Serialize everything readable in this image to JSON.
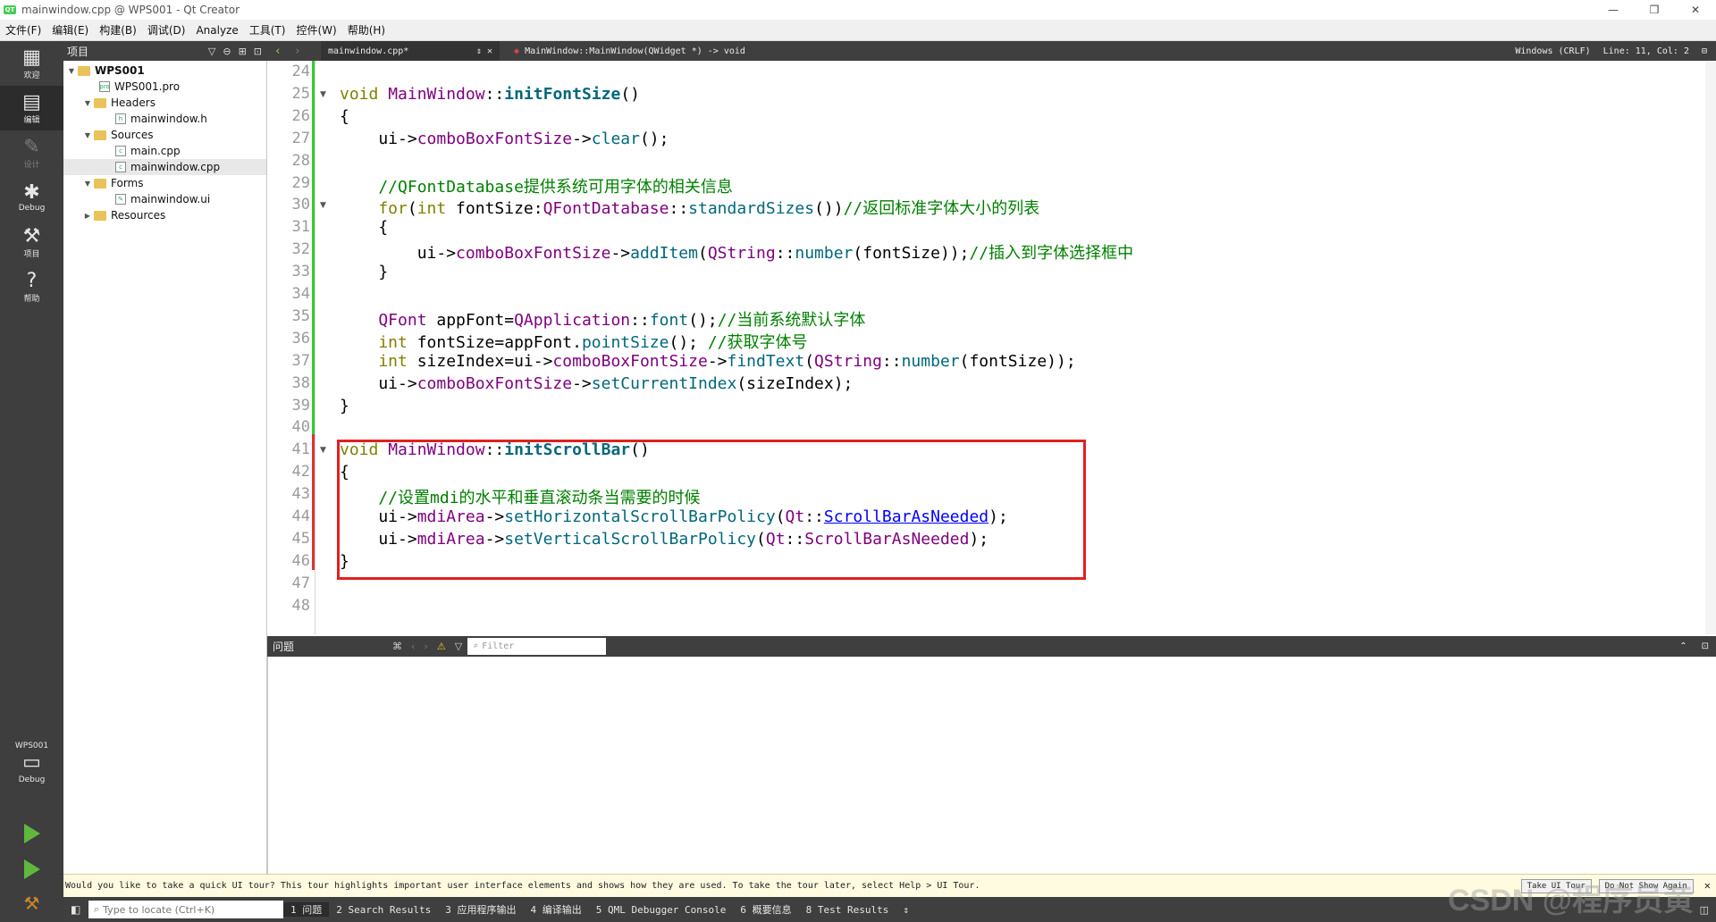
{
  "window": {
    "title": "mainwindow.cpp @ WPS001 - Qt Creator",
    "logo": "QT",
    "controls": [
      "—",
      "❐",
      "✕"
    ]
  },
  "menu": [
    "文件(F)",
    "编辑(E)",
    "构建(B)",
    "调试(D)",
    "Analyze",
    "工具(T)",
    "控件(W)",
    "帮助(H)"
  ],
  "modes": [
    {
      "label": "欢迎",
      "icon": "welcome-grid-icon"
    },
    {
      "label": "编辑",
      "icon": "edit-document-icon"
    },
    {
      "label": "设计",
      "icon": "design-pen-icon"
    },
    {
      "label": "Debug",
      "icon": "debug-bug-icon"
    },
    {
      "label": "项目",
      "icon": "project-wrench-icon"
    },
    {
      "label": "帮助",
      "icon": "help-question-icon"
    }
  ],
  "kit": {
    "project": "WPS001",
    "config": "Debug"
  },
  "project_pane": {
    "title": "项目",
    "tree": [
      "WPS001",
      "WPS001.pro",
      "Headers",
      "mainwindow.h",
      "Sources",
      "main.cpp",
      "mainwindow.cpp",
      "Forms",
      "mainwindow.ui",
      "Resources"
    ]
  },
  "editor": {
    "file_tab": "mainwindow.cpp*",
    "function": "MainWindow::MainWindow(QWidget *) -> void",
    "encoding": "Windows (CRLF)",
    "position": "Line: 11, Col: 2",
    "line_numbers": [
      "24",
      "25",
      "26",
      "27",
      "28",
      "29",
      "30",
      "31",
      "32",
      "33",
      "34",
      "35",
      "36",
      "37",
      "38",
      "39",
      "40",
      "41",
      "42",
      "43",
      "44",
      "45",
      "46",
      "47",
      "48"
    ],
    "code": {
      "l25_a": "void",
      "l25_b": " MainWindow",
      "l25_c": "::",
      "l25_d": "initFontSize",
      "l25_e": "()",
      "l26": "{",
      "l27_a": "    ui->",
      "l27_b": "comboBoxFontSize",
      "l27_c": "->",
      "l27_d": "clear",
      "l27_e": "();",
      "l29": "    //QFontDatabase提供系统可用字体的相关信息",
      "l30_a": "    for",
      "l30_b": "(",
      "l30_c": "int",
      "l30_d": " fontSize:",
      "l30_e": "QFontDatabase",
      "l30_f": "::",
      "l30_g": "standardSizes",
      "l30_h": "())",
      "l30_i": "//返回标准字体大小的列表",
      "l31": "    {",
      "l32_a": "        ui->",
      "l32_b": "comboBoxFontSize",
      "l32_c": "->",
      "l32_d": "addItem",
      "l32_e": "(",
      "l32_f": "QString",
      "l32_g": "::",
      "l32_h": "number",
      "l32_i": "(fontSize));",
      "l32_j": "//插入到字体选择框中",
      "l33": "    }",
      "l35_a": "    QFont",
      "l35_b": " appFont=",
      "l35_c": "QApplication",
      "l35_d": "::",
      "l35_e": "font",
      "l35_f": "();",
      "l35_g": "//当前系统默认字体",
      "l36_a": "    int",
      "l36_b": " fontSize=appFont.",
      "l36_c": "pointSize",
      "l36_d": "(); ",
      "l36_e": "//获取字体号",
      "l37_a": "    int",
      "l37_b": " sizeIndex=ui->",
      "l37_c": "comboBoxFontSize",
      "l37_d": "->",
      "l37_e": "findText",
      "l37_f": "(",
      "l37_g": "QString",
      "l37_h": "::",
      "l37_i": "number",
      "l37_j": "(fontSize));",
      "l38_a": "    ui->",
      "l38_b": "comboBoxFontSize",
      "l38_c": "->",
      "l38_d": "setCurrentIndex",
      "l38_e": "(sizeIndex);",
      "l39": "}",
      "l41_a": "void",
      "l41_b": " MainWindow",
      "l41_c": "::",
      "l41_d": "initScrollBar",
      "l41_e": "()",
      "l42": "{",
      "l43": "    //设置mdi的水平和垂直滚动条当需要的时候",
      "l44_a": "    ui->",
      "l44_b": "mdiArea",
      "l44_c": "->",
      "l44_d": "setHorizontalScrollBarPolicy",
      "l44_e": "(",
      "l44_f": "Qt",
      "l44_g": "::",
      "l44_h": "ScrollBarAsNeeded",
      "l44_i": ");",
      "l45_a": "    ui->",
      "l45_b": "mdiArea",
      "l45_c": "->",
      "l45_d": "setVerticalScrollBarPolicy",
      "l45_e": "(",
      "l45_f": "Qt",
      "l45_g": "::",
      "l45_h": "ScrollBarAsNeeded",
      "l45_i": ");",
      "l46": "}"
    }
  },
  "issues": {
    "title": "问题",
    "filter_placeholder": "Filter"
  },
  "tour": {
    "message": "Would you like to take a quick UI tour? This tour highlights important user interface elements and shows how they are used. To take the tour later, select Help > UI Tour.",
    "take_button": "Take UI Tour",
    "dismiss_button": "Do Not Show Again",
    "close": "✕"
  },
  "status": {
    "locate_placeholder": "Type to locate (Ctrl+K)",
    "tabs": [
      "1 问题",
      "2 Search Results",
      "3 应用程序输出",
      "4 编译输出",
      "5 QML Debugger Console",
      "6 概要信息",
      "8 Test Results"
    ]
  },
  "watermark": "CSDN @程序员黄小灰"
}
